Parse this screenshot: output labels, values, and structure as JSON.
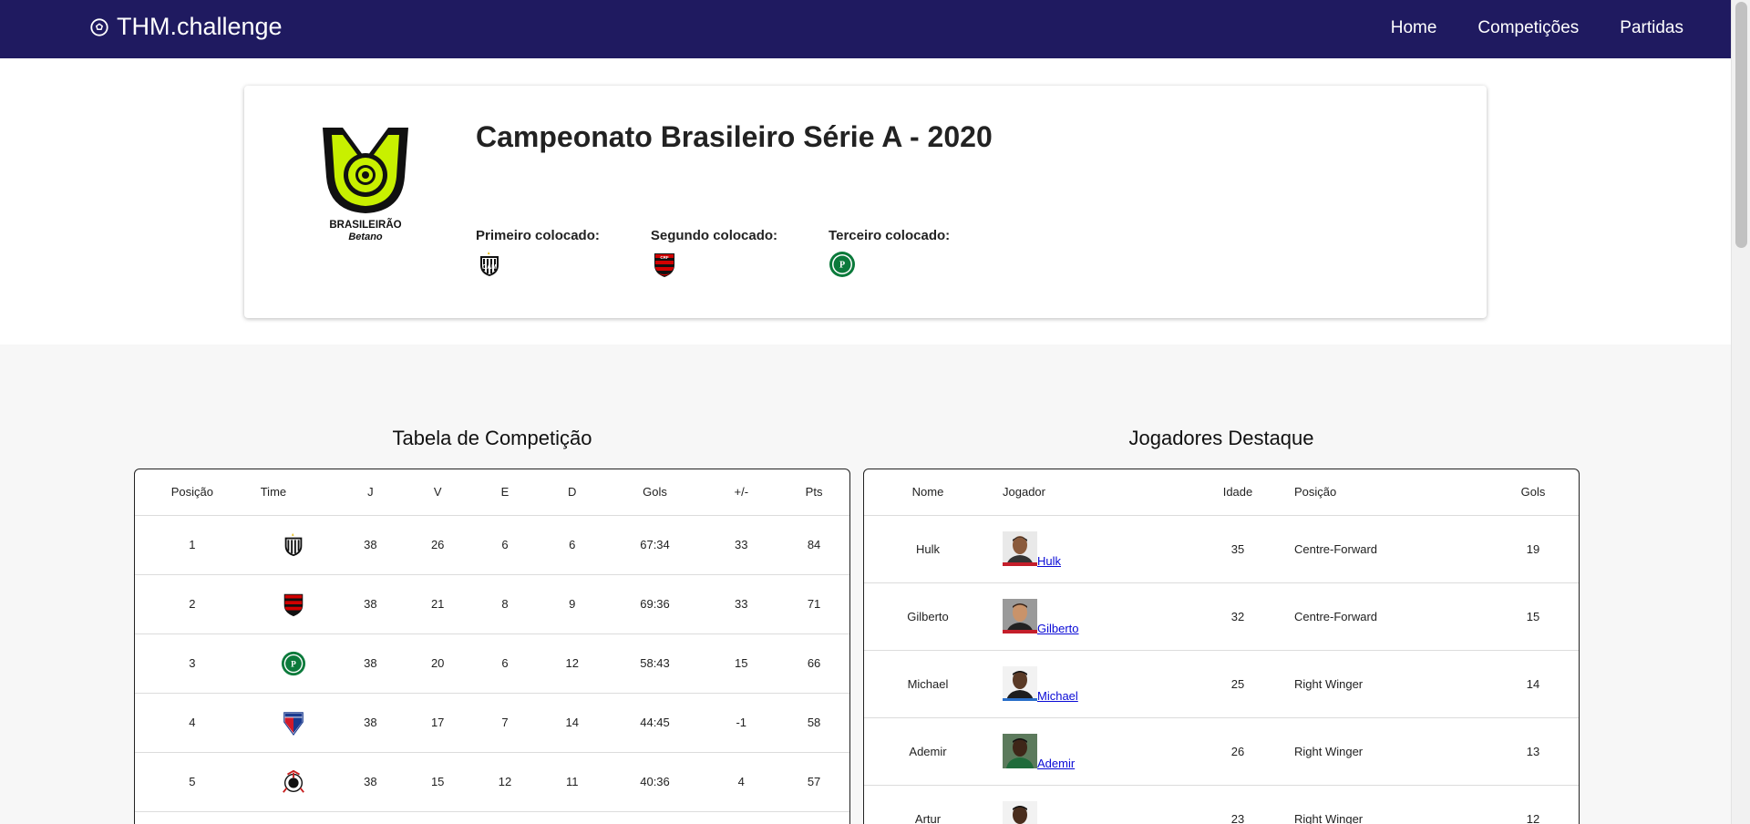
{
  "navbar": {
    "brand": "THM.challenge",
    "links": [
      "Home",
      "Competições",
      "Partidas"
    ]
  },
  "competition": {
    "title": "Campeonato Brasileiro Série A - 2020",
    "logo_text": "BRASILEIRÃO",
    "logo_sub": "Betano",
    "placings": [
      {
        "label": "Primeiro colocado:",
        "team": "Atlético Mineiro"
      },
      {
        "label": "Segundo colocado:",
        "team": "Flamengo"
      },
      {
        "label": "Terceiro colocado:",
        "team": "Palmeiras"
      }
    ]
  },
  "standings": {
    "title": "Tabela de Competição",
    "headers": [
      "Posição",
      "Time",
      "J",
      "V",
      "E",
      "D",
      "Gols",
      "+/-",
      "Pts"
    ],
    "rows": [
      {
        "pos": "1",
        "team": "Atlético Mineiro",
        "j": "38",
        "v": "26",
        "e": "6",
        "d": "6",
        "gols": "67:34",
        "diff": "33",
        "pts": "84"
      },
      {
        "pos": "2",
        "team": "Flamengo",
        "j": "38",
        "v": "21",
        "e": "8",
        "d": "9",
        "gols": "69:36",
        "diff": "33",
        "pts": "71"
      },
      {
        "pos": "3",
        "team": "Palmeiras",
        "j": "38",
        "v": "20",
        "e": "6",
        "d": "12",
        "gols": "58:43",
        "diff": "15",
        "pts": "66"
      },
      {
        "pos": "4",
        "team": "Fortaleza",
        "j": "38",
        "v": "17",
        "e": "7",
        "d": "14",
        "gols": "44:45",
        "diff": "-1",
        "pts": "58"
      },
      {
        "pos": "5",
        "team": "Corinthians",
        "j": "38",
        "v": "15",
        "e": "12",
        "d": "11",
        "gols": "40:36",
        "diff": "4",
        "pts": "57"
      }
    ]
  },
  "players": {
    "title": "Jogadores Destaque",
    "headers": [
      "Nome",
      "Jogador",
      "Idade",
      "Posição",
      "Gols"
    ],
    "rows": [
      {
        "nome": "Hulk",
        "link": "Hulk",
        "idade": "35",
        "posicao": "Centre-Forward",
        "gols": "19"
      },
      {
        "nome": "Gilberto",
        "link": "Gilberto",
        "idade": "32",
        "posicao": "Centre-Forward",
        "gols": "15"
      },
      {
        "nome": "Michael",
        "link": "Michael",
        "idade": "25",
        "posicao": "Right Winger",
        "gols": "14"
      },
      {
        "nome": "Ademir",
        "link": "Ademir",
        "idade": "26",
        "posicao": "Right Winger",
        "gols": "13"
      },
      {
        "nome": "Artur",
        "link": "",
        "idade": "23",
        "posicao": "Right Winger",
        "gols": "12"
      }
    ]
  },
  "colors": {
    "navbar": "#1f1a60",
    "logo_lime": "#c8f000",
    "link": "#0a0ad6"
  }
}
